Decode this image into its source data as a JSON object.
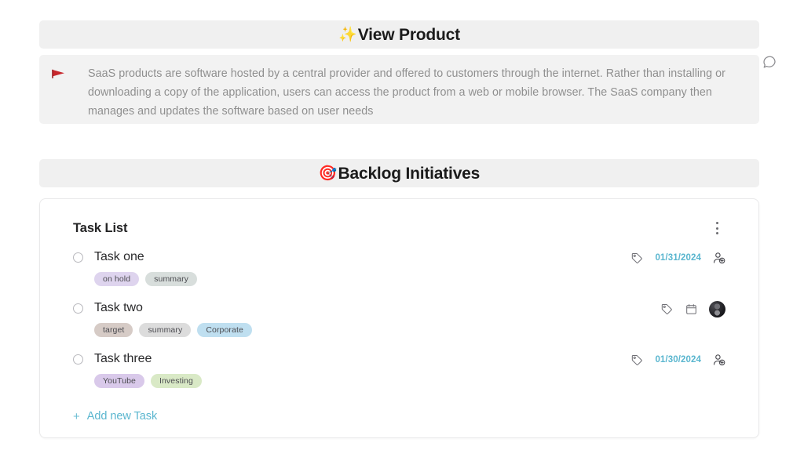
{
  "banners": [
    {
      "emoji": "✨",
      "title": "View Product",
      "name": "view-product"
    },
    {
      "emoji": "🎯",
      "title": "Backlog Initiatives",
      "name": "backlog-initiatives"
    }
  ],
  "callout": {
    "marker_icon": "red-triangle-marker-icon",
    "text": "SaaS products are software hosted by a central provider and offered to customers through the internet. Rather than installing or downloading a copy of the application, users can access the product from a web or mobile browser. The SaaS company then manages and updates the software based on user needs",
    "marker_color": "#c8272d",
    "text_color": "#8f8f8f",
    "background": "#f2f2f2"
  },
  "comment_fab": {
    "icon": "comment-bubble-icon"
  },
  "card": {
    "title": "Task List",
    "menu_icon": "more-vertical-icon",
    "add_task": {
      "plus": "+",
      "label": "Add new Task",
      "color": "#5ab6cf"
    },
    "tasks": [
      {
        "label": "Task one",
        "checked": false,
        "tags": [
          {
            "label": "on hold",
            "bg": "#ded4ee"
          },
          {
            "label": "summary",
            "bg": "#d8dedc"
          }
        ],
        "meta": {
          "tag_icon": "tag-icon",
          "date": "01/31/2024",
          "person_icon": "add-person-icon",
          "avatar": false,
          "calendar_icon": false
        }
      },
      {
        "label": "Task two",
        "checked": false,
        "tags": [
          {
            "label": "target",
            "bg": "#d6cbc6"
          },
          {
            "label": "summary",
            "bg": "#dcdcdc"
          },
          {
            "label": "Corporate",
            "bg": "#bfdff0"
          }
        ],
        "meta": {
          "tag_icon": "tag-icon",
          "date": "",
          "person_icon": "",
          "avatar": true,
          "calendar_icon": "calendar-icon"
        }
      },
      {
        "label": "Task three",
        "checked": false,
        "tags": [
          {
            "label": "YouTube",
            "bg": "#d9c9ea"
          },
          {
            "label": "Investing",
            "bg": "#d9e9c6"
          }
        ],
        "meta": {
          "tag_icon": "tag-icon",
          "date": "01/30/2024",
          "person_icon": "add-person-icon",
          "avatar": false,
          "calendar_icon": false
        }
      }
    ]
  },
  "colors": {
    "banner_bg": "#f0f0f0",
    "accent": "#5ab6cf",
    "card_border": "#e9e9ea",
    "page_bg": "#ffffff"
  }
}
